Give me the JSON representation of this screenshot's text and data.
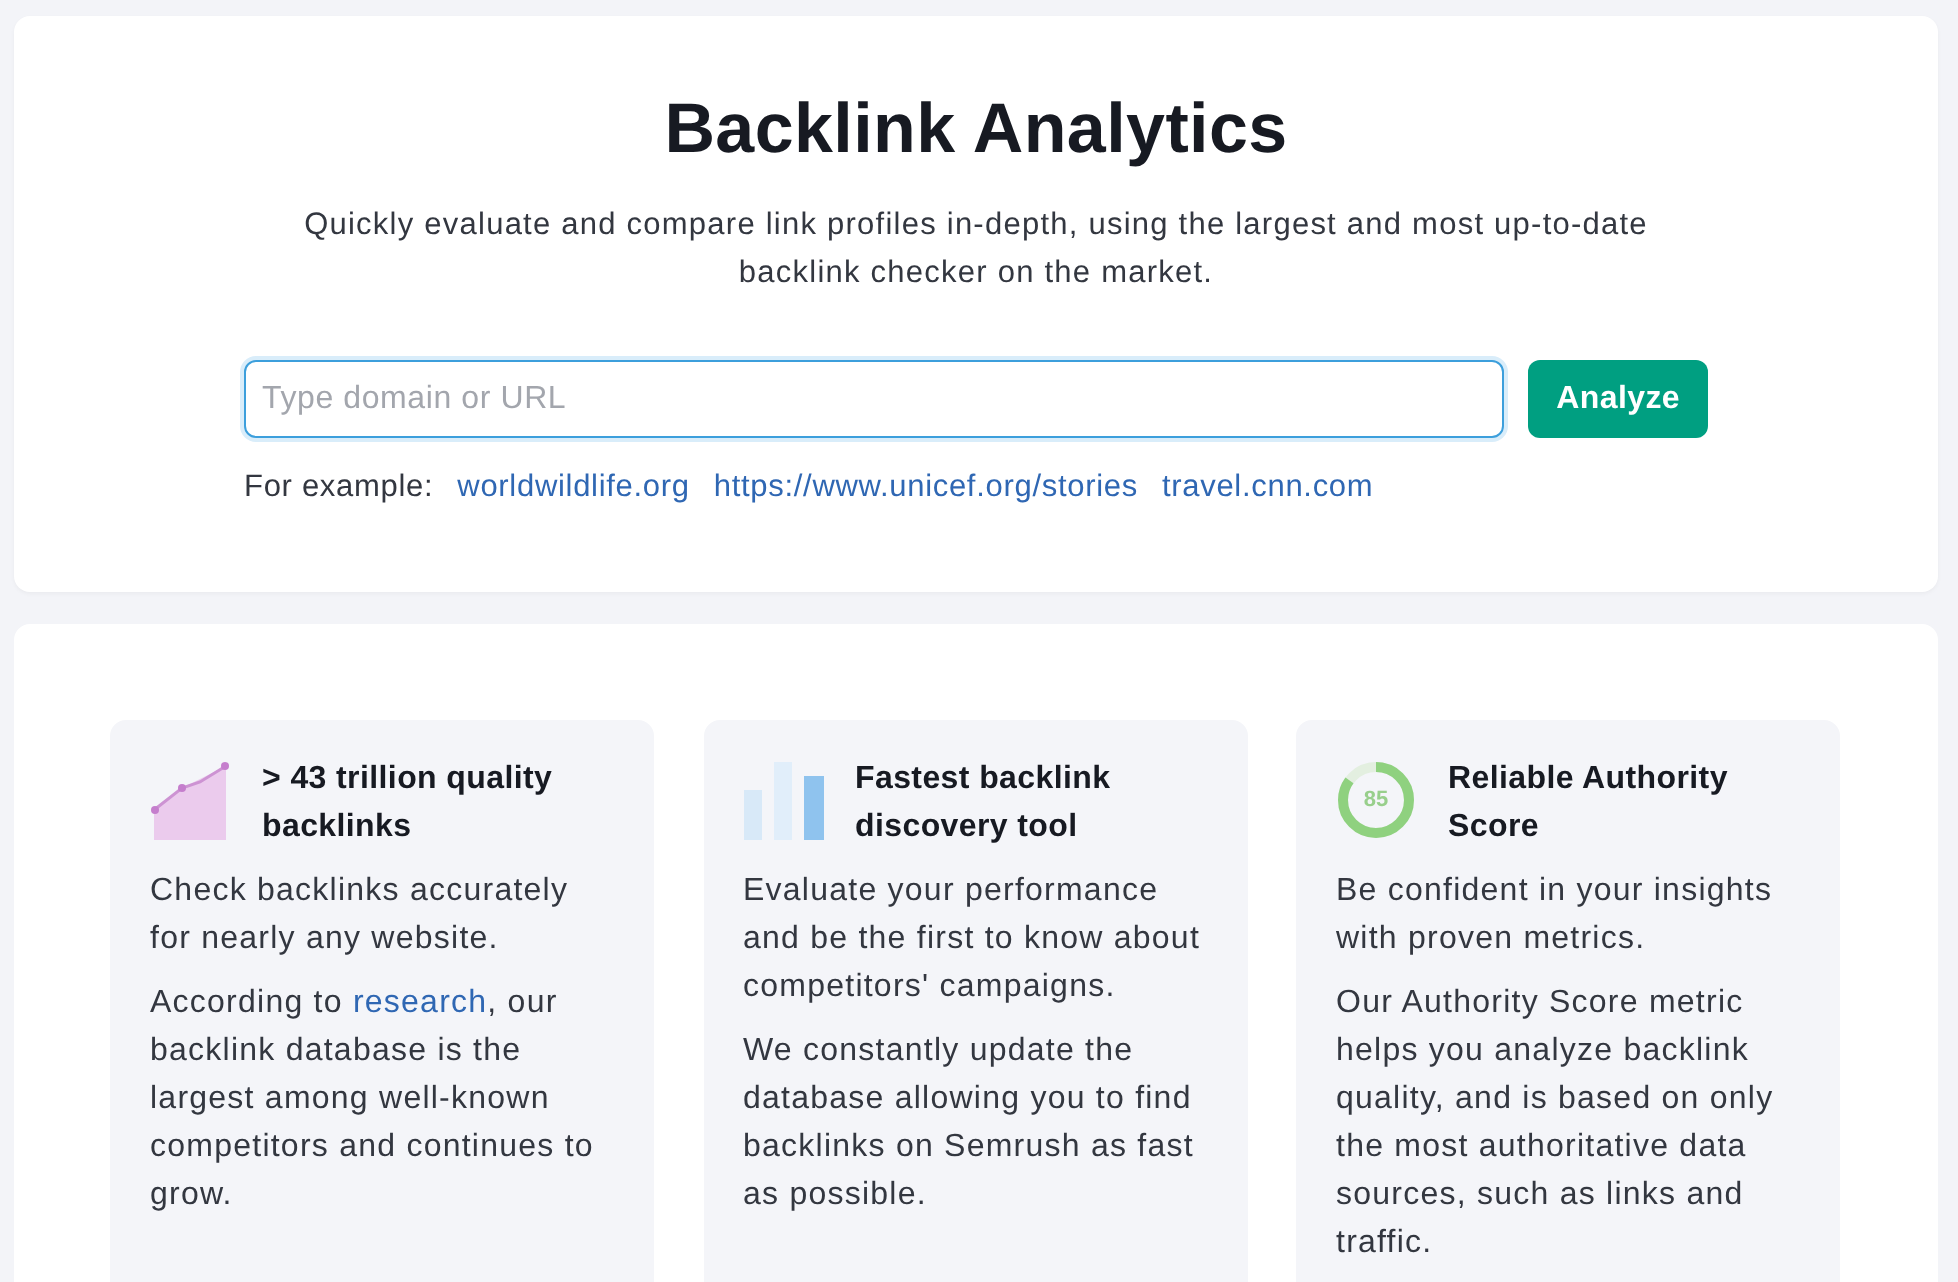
{
  "header": {
    "title": "Backlink Analytics",
    "subtitle": "Quickly evaluate and compare link profiles in-depth, using the largest and most up-to-date backlink checker on the market.",
    "search": {
      "placeholder": "Type domain or URL",
      "focused": true
    },
    "button": "Analyze",
    "examples": {
      "label": "For example:",
      "links": [
        "worldwildlife.org",
        "https://www.unicef.org/stories",
        "travel.cnn.com"
      ]
    }
  },
  "features": [
    {
      "kind": "area-chart",
      "title": "> 43 trillion quality backlinks",
      "paragraphs": [
        [
          {
            "kind": "text",
            "text": "Check backlinks accurately for nearly any website."
          }
        ],
        [
          {
            "kind": "text",
            "text": "According to "
          },
          {
            "kind": "link",
            "text": "research"
          },
          {
            "kind": "text",
            "text": ", our backlink database is the largest among well-known competitors and continues to grow."
          }
        ]
      ]
    },
    {
      "kind": "bar-chart",
      "title": "Fastest backlink discovery tool",
      "paragraphs": [
        [
          {
            "kind": "text",
            "text": "Evaluate your performance and be the first to know about competitors' campaigns."
          }
        ],
        [
          {
            "kind": "text",
            "text": "We constantly update the database allowing you to find backlinks on Semrush as fast as possible."
          }
        ]
      ]
    },
    {
      "kind": "score-ring",
      "score": "85",
      "title": "Reliable Authority Score",
      "paragraphs": [
        [
          {
            "kind": "text",
            "text": "Be confident in your insights with proven metrics."
          }
        ],
        [
          {
            "kind": "text",
            "text": "Our Authority Score metric helps you analyze backlink quality, and is based on only the most authoritative data sources, such as links and traffic."
          }
        ]
      ]
    }
  ]
}
